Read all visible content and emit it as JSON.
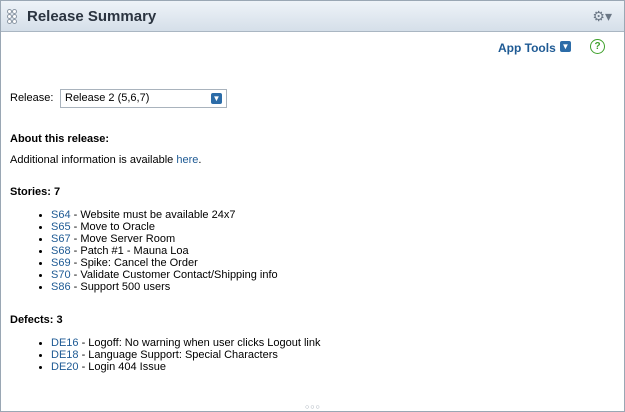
{
  "header": {
    "title": "Release Summary"
  },
  "app_tools": {
    "label": "App Tools"
  },
  "release": {
    "label": "Release:",
    "selected": "Release 2 (5,6,7)"
  },
  "about": {
    "heading": "About this release:",
    "text_prefix": "Additional information is available ",
    "link": "here",
    "text_suffix": "."
  },
  "stories": {
    "heading": "Stories: 7",
    "items": [
      {
        "id": "S64",
        "title": " - Website must be available 24x7"
      },
      {
        "id": "S65",
        "title": " - Move to Oracle"
      },
      {
        "id": "S67",
        "title": " - Move Server Room"
      },
      {
        "id": "S68",
        "title": " - Patch #1 - Mauna Loa"
      },
      {
        "id": "S69",
        "title": " - Spike: Cancel the Order"
      },
      {
        "id": "S70",
        "title": " - Validate Customer Contact/Shipping info"
      },
      {
        "id": "S86",
        "title": " - Support 500 users"
      }
    ]
  },
  "defects": {
    "heading": "Defects: 3",
    "items": [
      {
        "id": "DE16",
        "title": " - Logoff: No warning when user clicks Logout link"
      },
      {
        "id": "DE18",
        "title": " - Language Support: Special Characters"
      },
      {
        "id": "DE20",
        "title": " - Login 404 Issue"
      }
    ]
  }
}
